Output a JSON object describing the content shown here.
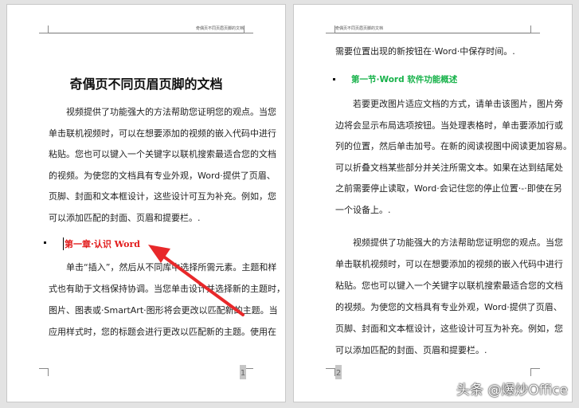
{
  "header_text": "奇偶页不同页眉页脚的文档",
  "page1": {
    "title": "奇偶页不同页眉页脚的文档",
    "para1": [
      "视频提供了功能强大的方法帮助您证明您的观点。当您",
      "单击联机视频时，可以在想要添加的视频的嵌入代码中进行",
      "粘贴。您也可以键入一个关键字以联机搜索最适合您的文档",
      "的视频。为使您的文档具有专业外观，Word·提供了页眉、",
      "页脚、封面和文本框设计，这些设计可互为补充。例如，您",
      "可以添加匹配的封面、页眉和提要栏。."
    ],
    "heading": "第一章·认识 Word",
    "para2": [
      "单击“插入”，然后从不同库中选择所需元素。主题和样",
      "式也有助于文档保持协调。当您单击设计并选择新的主题时，",
      "图片、图表或·SmartArt·图形将会更改以匹配新的主题。当",
      "应用样式时，您的标题会进行更改以匹配新的主题。使用在"
    ],
    "page_number": "1"
  },
  "page2": {
    "first_line": "需要位置出现的新按钮在·Word·中保存时间。.",
    "heading": "第一节·Word 软件功能概述",
    "para1": [
      "若要更改图片适应文档的方式，请单击该图片，图片旁",
      "边将会显示布局选项按钮。当处理表格时，单击要添加行或",
      "列的位置，然后单击加号。在新的阅读视图中阅读更加容易。",
      "可以折叠文档某些部分并关注所需文本。如果在达到结尾处",
      "之前需要停止读取，Word·会记住您的停止位置·-·即使在另",
      "一个设备上。."
    ],
    "para2": [
      "视频提供了功能强大的方法帮助您证明您的观点。当您",
      "单击联机视频时，可以在想要添加的视频的嵌入代码中进行",
      "粘贴。您也可以键入一个关键字以联机搜索最适合您的文档",
      "的视频。为使您的文档具有专业外观，Word·提供了页眉、",
      "页脚、封面和文本框设计，这些设计可互为补充。例如，您",
      "可以添加匹配的封面、页眉和提要栏。."
    ],
    "page_number": "2"
  },
  "watermark": "头条 @爆炒Office",
  "colors": {
    "heading1": "#e21b1b",
    "heading2": "#17b24a",
    "arrow": "#e8282a"
  }
}
